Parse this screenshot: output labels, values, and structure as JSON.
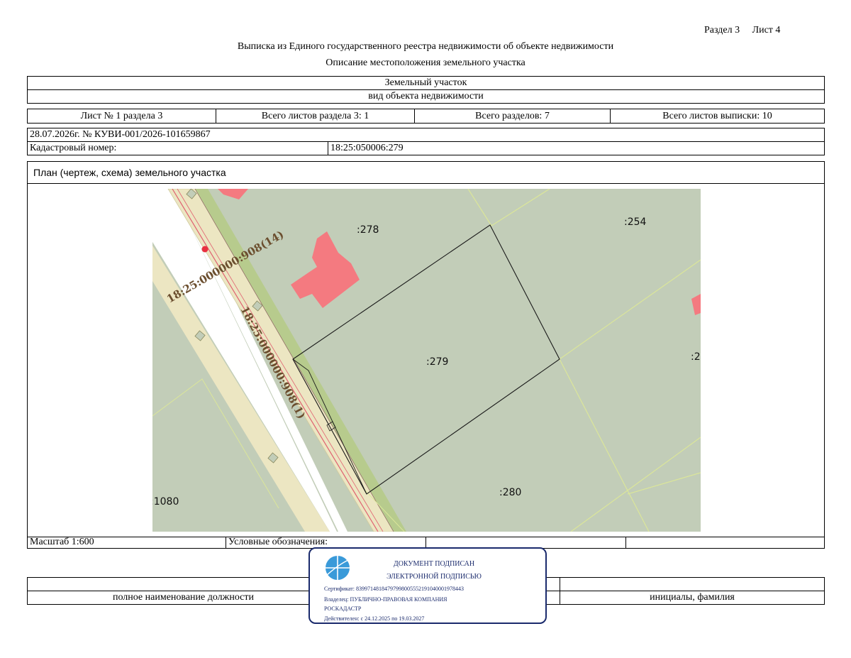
{
  "header": {
    "section": "Раздел 3",
    "sheet": "Лист 4",
    "title": "Выписка из Единого государственного реестра недвижимости об объекте недвижимости",
    "subtitle": "Описание местоположения земельного участка"
  },
  "object": {
    "name": "Земельный участок",
    "kind": "вид объекта недвижимости"
  },
  "sheets": {
    "sheet_no": "Лист № 1 раздела 3",
    "total_section_sheets": "Всего листов раздела 3: 1",
    "total_sections": "Всего разделов: 7",
    "total_extract_sheets": "Всего листов выписки: 10"
  },
  "record": {
    "date_number": "28.07.2026г. № КУВИ-001/2026-101659867",
    "cadastral_label": "Кадастровый номер:",
    "cadastral_value": "18:25:050006:279"
  },
  "plan": {
    "title": "План (чертеж, схема) земельного участка",
    "labels": {
      "p278": ":278",
      "p254": ":254",
      "p279": ":279",
      "p280": ":280",
      "p1080": ":1080",
      "p2": ":2",
      "road14": "18:25:000000:908(14)",
      "road1": "18:25:000000:908(1)"
    },
    "colors": {
      "parcel_fill": "#c2cdb8",
      "road_fill": "#ece6c2",
      "building_fill": "#f47a80",
      "strip_fill": "#b7cb8d",
      "boundary_line": "#dbe69a"
    }
  },
  "footer_row": {
    "scale": "Масштаб 1:600",
    "legend": "Условные обозначения:"
  },
  "signature": {
    "position": "полное наименование должности",
    "name": "инициалы, фамилия"
  },
  "stamp": {
    "line1": "ДОКУМЕНТ ПОДПИСАН",
    "line2": "ЭЛЕКТРОННОЙ ПОДПИСЬЮ",
    "certificate": "Сертификат: 8399714818479799800555219104000197844З",
    "owner1": "Владелец: ПУБЛИЧНО-ПРАВОВАЯ КОМПАНИЯ",
    "owner2": "РОСКАДАСТР",
    "validity": "Действителен: с 24.12.2025 по 19.03.2027"
  }
}
